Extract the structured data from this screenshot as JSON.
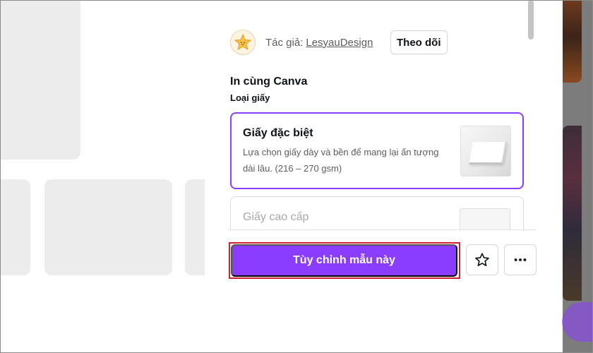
{
  "template": {
    "author_label": "Tác giả:",
    "author_name": "LesyauDesign",
    "follow_label": "Theo dõi"
  },
  "print": {
    "title": "In cùng Canva",
    "paper_type_label": "Loại giấy",
    "options": [
      {
        "name": "Giấy đặc biệt",
        "description": "Lựa chọn giấy dày và bền để mang lại ấn tượng dài lâu. (216 – 270 gsm)",
        "selected": true
      },
      {
        "name": "Giấy cao cấp",
        "selected": false
      }
    ]
  },
  "footer": {
    "customize_label": "Tùy chỉnh mẫu này",
    "star_icon": "star-icon",
    "more_icon": "more-horizontal-icon"
  },
  "colors": {
    "accent": "#8b3dff",
    "highlight": "#d01f2f"
  }
}
